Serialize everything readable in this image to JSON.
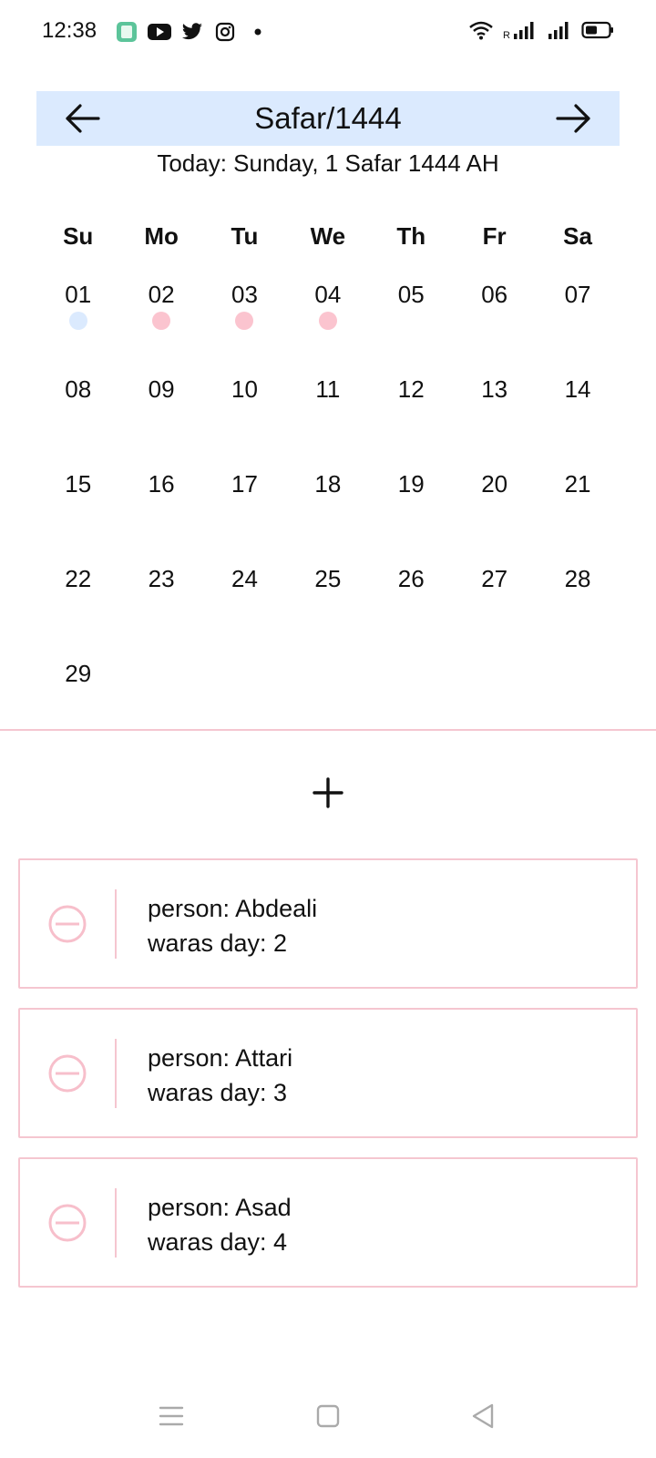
{
  "status_bar": {
    "time": "12:38",
    "left_icons": [
      "notes-app-icon",
      "youtube-icon",
      "twitter-icon",
      "instagram-icon",
      "notification-dot-icon"
    ],
    "right_icons": [
      "wifi-icon",
      "signal-roaming-icon",
      "signal-icon",
      "battery-icon"
    ]
  },
  "calendar": {
    "month_title": "Safar/1444",
    "today_label": "Today: Sunday, 1 Safar 1444 AH",
    "weekdays": [
      "Su",
      "Mo",
      "Tu",
      "We",
      "Th",
      "Fr",
      "Sa"
    ],
    "days": [
      "01",
      "02",
      "03",
      "04",
      "05",
      "06",
      "07",
      "08",
      "09",
      "10",
      "11",
      "12",
      "13",
      "14",
      "15",
      "16",
      "17",
      "18",
      "19",
      "20",
      "21",
      "22",
      "23",
      "24",
      "25",
      "26",
      "27",
      "28",
      "29"
    ],
    "today_day": "01",
    "marked_days": [
      "02",
      "03",
      "04"
    ],
    "colors": {
      "header_bg": "#dbeafe",
      "today_dot": "#dbeafe",
      "marked_dot": "#fbc4cf"
    }
  },
  "actions": {
    "add_icon": "plus-icon"
  },
  "entries": [
    {
      "person": "person: Abdeali",
      "day": "waras day: 2"
    },
    {
      "person": "person: Attari",
      "day": "waras day: 3"
    },
    {
      "person": "person: Asad",
      "day": "waras day: 4"
    }
  ],
  "colors": {
    "accent_pink": "#f5c6d0",
    "remove_icon": "#f7bfcb"
  }
}
